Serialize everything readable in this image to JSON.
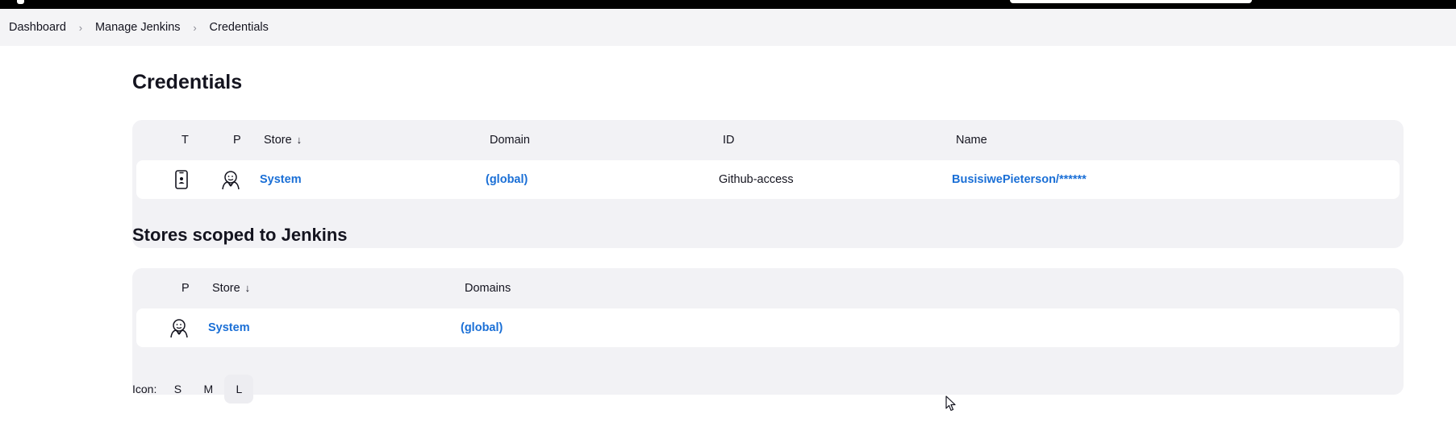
{
  "breadcrumb": [
    {
      "label": "Dashboard"
    },
    {
      "label": "Manage Jenkins"
    },
    {
      "label": "Credentials"
    }
  ],
  "page_title": "Credentials",
  "credentials_table": {
    "headers": {
      "t": "T",
      "p": "P",
      "store": "Store",
      "sort_arrow": "↓",
      "domain": "Domain",
      "id": "ID",
      "name": "Name"
    },
    "rows": [
      {
        "type_icon": "phone-credential-icon",
        "provider_icon": "jenkins-butler-icon",
        "store": "System",
        "domain": "(global)",
        "id": "Github-access",
        "name": "BusisiwePieterson/******"
      }
    ]
  },
  "stores_section_title": "Stores scoped to Jenkins",
  "stores_table": {
    "headers": {
      "p": "P",
      "store": "Store",
      "sort_arrow": "↓",
      "domains": "Domains"
    },
    "rows": [
      {
        "provider_icon": "jenkins-butler-icon",
        "store": "System",
        "domains": "(global)"
      }
    ]
  },
  "icon_size": {
    "label": "Icon:",
    "options": [
      "S",
      "M",
      "L"
    ],
    "selected": "L"
  },
  "colors": {
    "link": "#1a6fd6",
    "topbar": "#000000",
    "table_bg": "#f2f2f5"
  }
}
